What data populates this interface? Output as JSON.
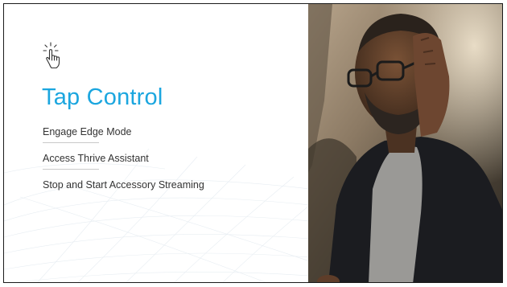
{
  "slide": {
    "title": "Tap Control",
    "items": [
      {
        "label": "Engage Edge Mode"
      },
      {
        "label": "Access Thrive Assistant"
      },
      {
        "label": "Stop and Start Accessory Streaming"
      }
    ]
  },
  "icons": {
    "tap": "tap-gesture-icon"
  },
  "colors": {
    "title": "#1ba6df",
    "text": "#333333",
    "divider": "#c9c9c9",
    "border": "#1a1a1a"
  },
  "photo": {
    "description": "man with glasses touching his ear"
  }
}
